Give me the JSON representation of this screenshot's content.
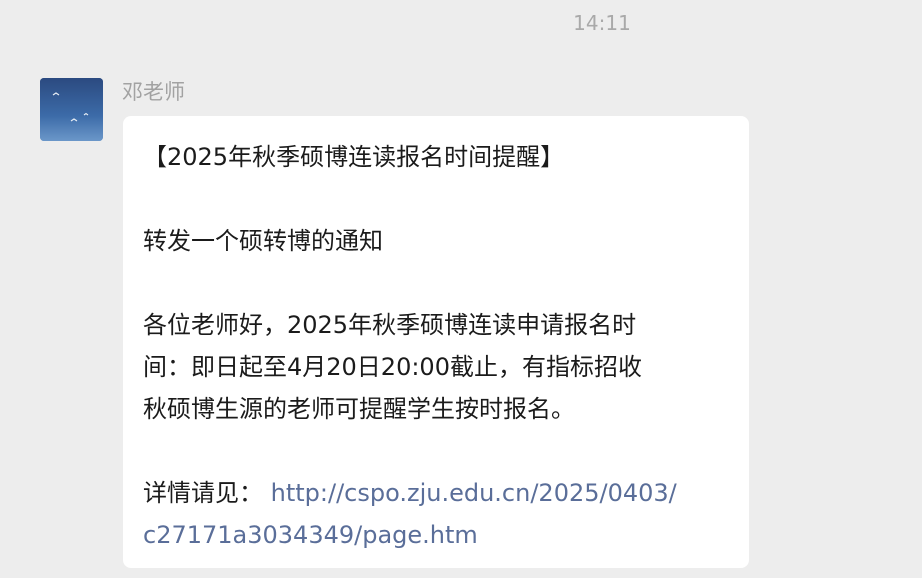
{
  "chat": {
    "timestamp": "14:11",
    "sender_name": "邓老师",
    "message": {
      "title": "【2025年秋季硕博连读报名时间提醒】",
      "intro": "转发一个硕转博的通知",
      "body_line1": "各位老师好，2025年秋季硕博连读申请报名时",
      "body_line2": "间：即日起至4月20日20:00截止，有指标招收",
      "body_line3": "秋硕博生源的老师可提醒学生按时报名。",
      "details_label": "详情请见：",
      "link_part1": "http://cspo.zju.edu.cn/2025/0403/",
      "link_part2": "c27171a3034349/page.htm"
    }
  },
  "colors": {
    "background": "#ededed",
    "bubble": "#ffffff",
    "link": "#5a6e99",
    "muted_text": "#a9a9a9"
  },
  "icons": {
    "avatar": "sky-with-birds-avatar"
  }
}
